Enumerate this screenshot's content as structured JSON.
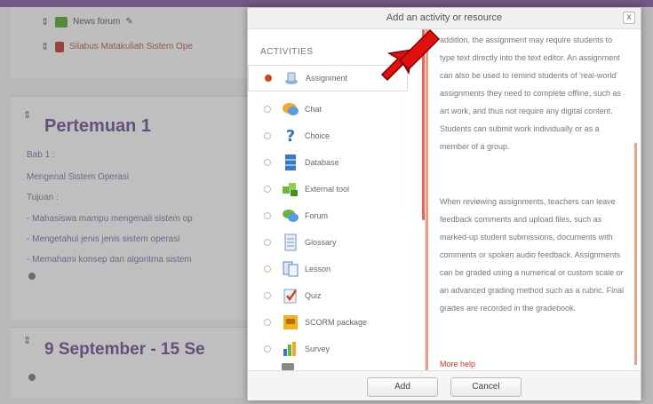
{
  "background": {
    "top_items": [
      {
        "label": "News forum",
        "color": "#5aa02c"
      },
      {
        "label": "Silabus Matakuliah Sistem Ope",
        "color": "#c0392b"
      }
    ],
    "section1": {
      "title": "Pertemuan 1",
      "lines": [
        "Bab 1 :",
        "Mengenal Sistem Operasi",
        "Tujuan :",
        "- Mahasiswa mampu mengenali sistem op",
        "- Mengetahui jenis jenis sistem operasi",
        "- Memahami konsep dan algoritma sistem"
      ]
    },
    "section2": {
      "title": "9 September - 15 Se"
    }
  },
  "dialog": {
    "title": "Add an activity or resource",
    "close_label": "x",
    "activities_heading": "ACTIVITIES",
    "modules": [
      {
        "label": "Assignment",
        "icon": "assignment-icon",
        "selected": true
      },
      {
        "label": "Chat",
        "icon": "chat-icon",
        "selected": false
      },
      {
        "label": "Choice",
        "icon": "choice-icon",
        "selected": false
      },
      {
        "label": "Database",
        "icon": "database-icon",
        "selected": false
      },
      {
        "label": "External tool",
        "icon": "external-tool-icon",
        "selected": false
      },
      {
        "label": "Forum",
        "icon": "forum-icon",
        "selected": false
      },
      {
        "label": "Glossary",
        "icon": "glossary-icon",
        "selected": false
      },
      {
        "label": "Lesson",
        "icon": "lesson-icon",
        "selected": false
      },
      {
        "label": "Quiz",
        "icon": "quiz-icon",
        "selected": false
      },
      {
        "label": "SCORM package",
        "icon": "scorm-icon",
        "selected": false
      },
      {
        "label": "Survey",
        "icon": "survey-icon",
        "selected": false
      }
    ],
    "help_paragraphs": [
      "addition, the assignment may require students to type text directly into the text editor. An assignment can also be used to remind students of 'real-world' assignments they need to complete offline, such as art work, and thus not require any digital content. Students can submit work individually or as a member of a group.",
      "When reviewing assignments, teachers can leave feedback comments and upload files, such as marked-up student submissions, documents with comments or spoken audio feedback. Assignments can be graded using a numerical or custom scale or an advanced grading method such as a rubric. Final grades are recorded in the gradebook."
    ],
    "more_help": "More help",
    "add_label": "Add",
    "cancel_label": "Cancel"
  },
  "colors": {
    "accent": "#d14321",
    "header_purple": "#7d5a9c",
    "arrow": "#e01010"
  }
}
